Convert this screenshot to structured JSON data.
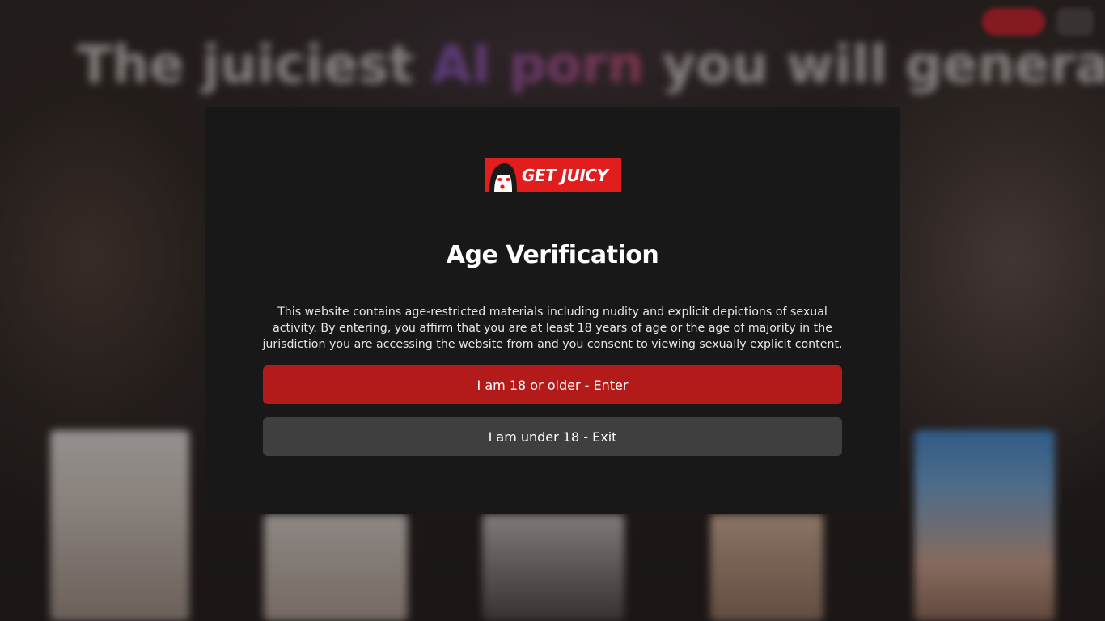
{
  "background": {
    "headline_prefix": "The juiciest ",
    "headline_accent": "AI porn",
    "headline_suffix": " you will generate."
  },
  "logo": {
    "text": "GET JUICY",
    "brand_color": "#e11d1d"
  },
  "modal": {
    "title": "Age Verification",
    "description": "This website contains age-restricted materials including nudity and explicit depictions of sexual activity. By entering, you affirm that you are at least 18 years of age or the age of majority in the jurisdiction you are accessing the website from and you consent to viewing sexually explicit content.",
    "enter_label": "I am 18 or older - Enter",
    "exit_label": "I am under 18 - Exit",
    "enter_color": "#b31b1b",
    "exit_color": "#3f3f3f"
  }
}
